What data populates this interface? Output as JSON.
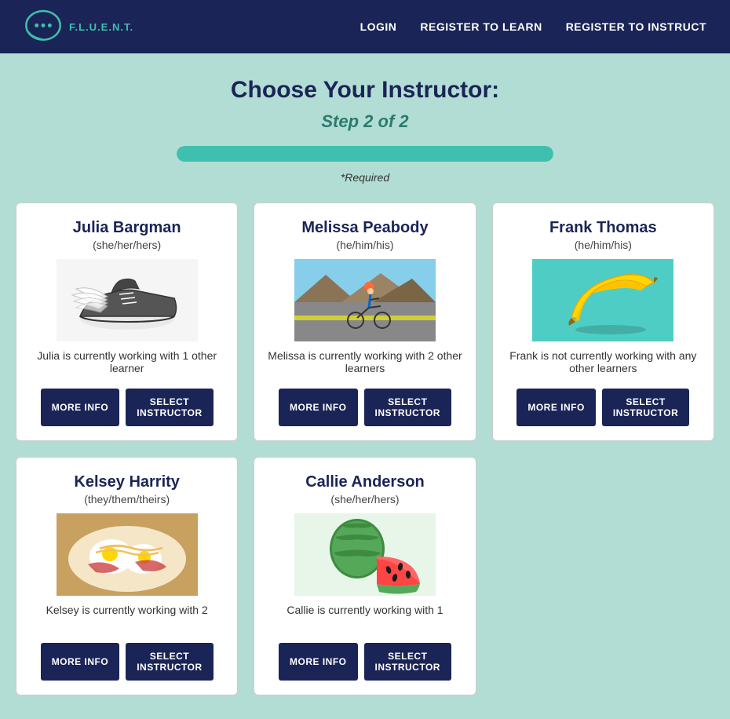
{
  "header": {
    "logo_text": "F.L.U.E.N.T.",
    "nav": {
      "login": "LOGIN",
      "register_learn": "REGISTER TO LEARN",
      "register_instruct": "REGISTER TO INSTRUCT"
    }
  },
  "main": {
    "title": "Choose Your Instructor:",
    "step": "Step 2 of 2",
    "progress_percent": 100,
    "required": "*Required",
    "instructors": [
      {
        "name": "Julia Bargman",
        "pronouns": "(she/her/hers)",
        "status": "Julia is currently working with 1 other learner",
        "image_type": "shoe"
      },
      {
        "name": "Melissa Peabody",
        "pronouns": "(he/him/his)",
        "status": "Melissa is currently working with 2 other learners",
        "image_type": "cyclist"
      },
      {
        "name": "Frank Thomas",
        "pronouns": "(he/him/his)",
        "status": "Frank is not currently working with any other learners",
        "image_type": "banana"
      },
      {
        "name": "Kelsey Harrity",
        "pronouns": "(they/them/theirs)",
        "status": "Kelsey is currently working with 2",
        "image_type": "food"
      },
      {
        "name": "Callie Anderson",
        "pronouns": "(she/her/hers)",
        "status": "Callie is currently working with 1",
        "image_type": "watermelon"
      }
    ],
    "buttons": {
      "more_info": "MORE INFO",
      "select": "SELECT INSTRUCTOR"
    }
  }
}
